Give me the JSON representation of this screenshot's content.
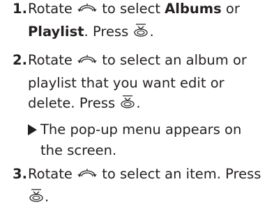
{
  "steps": [
    {
      "number": "1.",
      "part1": "Rotate",
      "part2": "to select",
      "kw1": "Albums",
      "mid": "or",
      "kw2": "Playlist",
      "end": ". Press"
    },
    {
      "number": "2.",
      "part1": "Rotate",
      "part2": "to select an album or",
      "line2": "playlist that you want edit or",
      "line3a": "delete. Press"
    },
    {
      "number": "3.",
      "part1": "Rotate",
      "part2": "to select an item. Press"
    }
  ],
  "result": {
    "line1": "The pop-up menu appears on",
    "line2": "the screen."
  },
  "icons": {
    "rotate": "rotate-dial-icon",
    "press": "press-button-icon",
    "result": "triangle-bullet-icon"
  },
  "period": "."
}
